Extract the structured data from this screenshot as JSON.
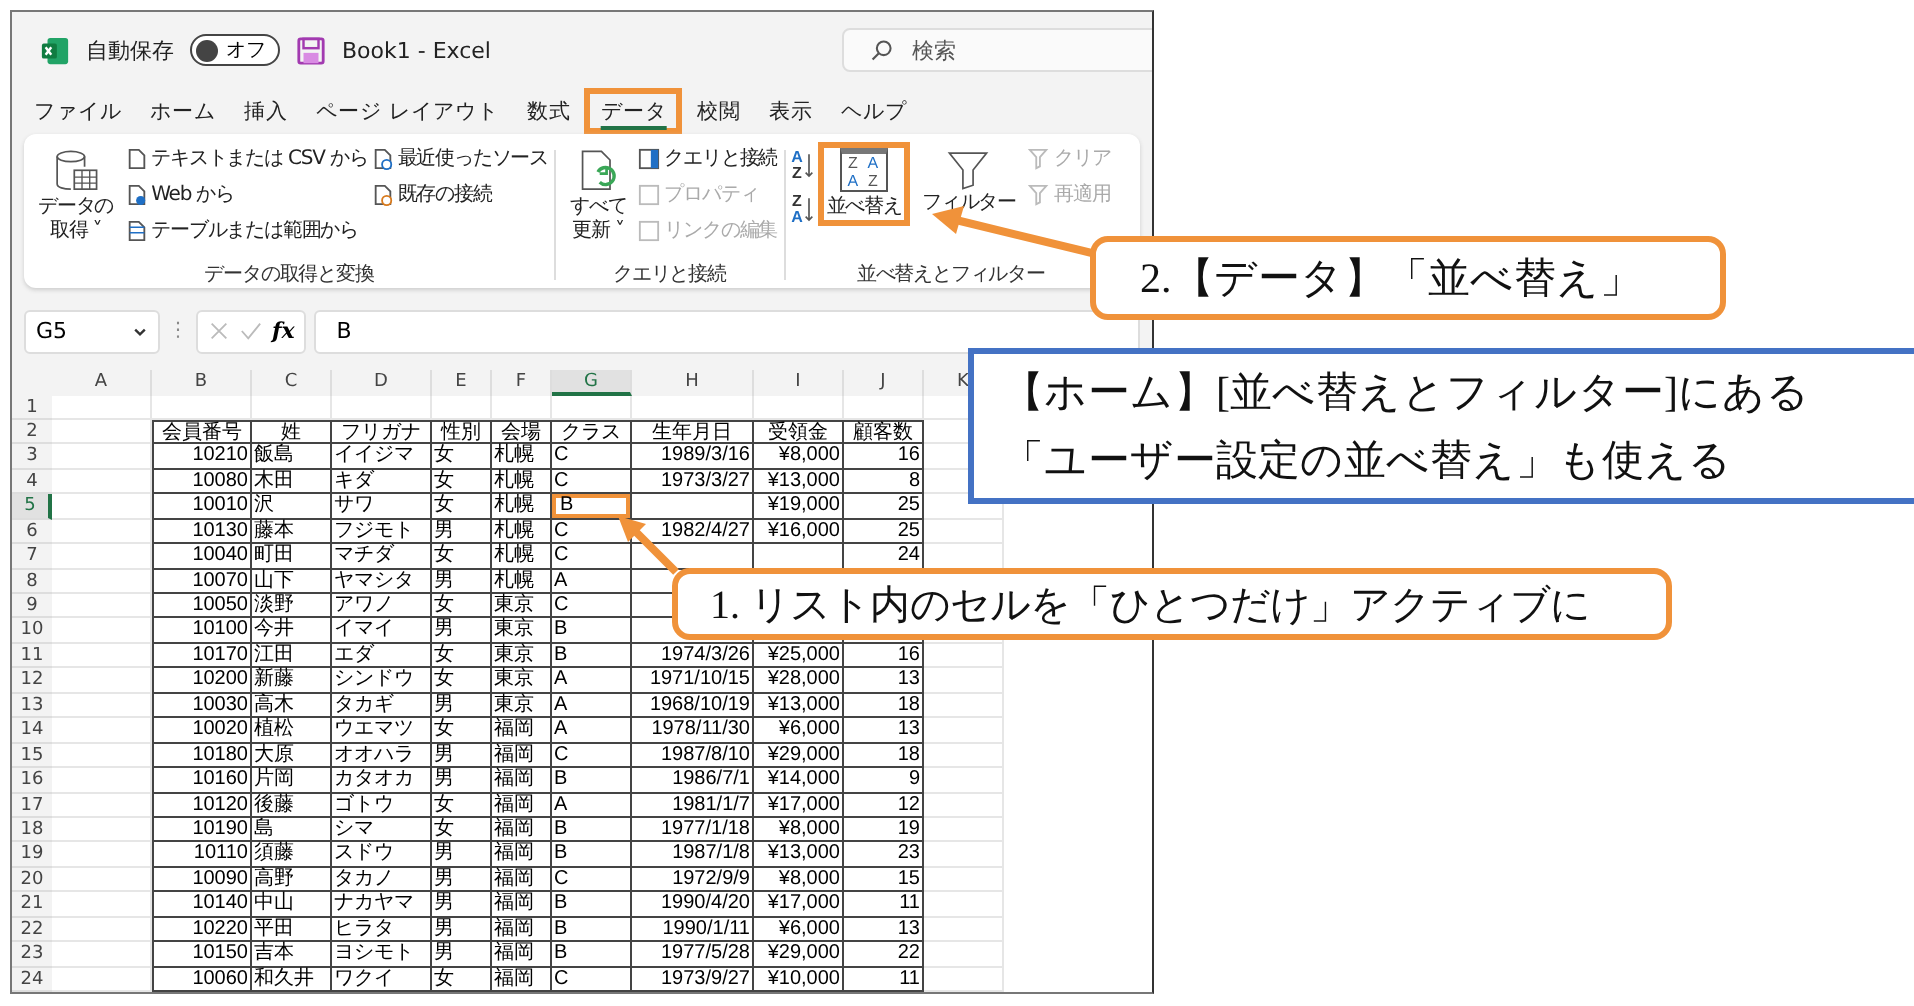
{
  "title_bar": {
    "autosave_label": "自動保存",
    "toggle": {
      "label": "オフ",
      "on": false
    },
    "document_title": "Book1  -  Excel",
    "search": {
      "placeholder": "検索"
    }
  },
  "tabs": [
    {
      "label": "ファイル",
      "selected": false,
      "highlighted": false
    },
    {
      "label": "ホーム",
      "selected": false,
      "highlighted": false
    },
    {
      "label": "挿入",
      "selected": false,
      "highlighted": false
    },
    {
      "label": "ページ レイアウト",
      "selected": false,
      "highlighted": false
    },
    {
      "label": "数式",
      "selected": false,
      "highlighted": false
    },
    {
      "label": "データ",
      "selected": true,
      "highlighted": true
    },
    {
      "label": "校閲",
      "selected": false,
      "highlighted": false
    },
    {
      "label": "表示",
      "selected": false,
      "highlighted": false
    },
    {
      "label": "ヘルプ",
      "selected": false,
      "highlighted": false
    }
  ],
  "ribbon": {
    "groups": [
      {
        "label": "データの取得と変換",
        "large": [
          {
            "label": "データの",
            "label2": "取得 ˅",
            "highlighted": false
          }
        ],
        "small": [
          {
            "label": "テキストまたは CSV から",
            "disabled": false
          },
          {
            "label": "Web から",
            "disabled": false
          },
          {
            "label": "テーブルまたは範囲から",
            "disabled": false
          },
          {
            "label": "最近使ったソース",
            "disabled": false
          },
          {
            "label": "既存の接続",
            "disabled": false
          }
        ]
      },
      {
        "label": "クエリと接続",
        "large": [
          {
            "label": "すべて",
            "label2": "更新 ˅",
            "highlighted": false
          }
        ],
        "small": [
          {
            "label": "クエリと接続",
            "disabled": false
          },
          {
            "label": "プロパティ",
            "disabled": true
          },
          {
            "label": "リンクの編集",
            "disabled": true
          }
        ]
      },
      {
        "label": "並べ替えとフィルター",
        "sort_buttons": [
          {
            "top": "A",
            "bottom": "Z"
          },
          {
            "top": "Z",
            "bottom": "A"
          }
        ],
        "sort_icon_letters": [
          "Z",
          "A",
          "A",
          "Z"
        ],
        "large": [
          {
            "label": "並べ替え",
            "highlighted": true
          },
          {
            "label": "フィルター",
            "highlighted": false
          }
        ],
        "small": [
          {
            "label": "クリア",
            "disabled": true
          },
          {
            "label": "再適用",
            "disabled": true
          }
        ]
      }
    ]
  },
  "formula_bar": {
    "name_box": "G5",
    "separator": "⋮",
    "fx": "fx",
    "value": "B"
  },
  "grid": {
    "active_cell_highlighted": true,
    "columns": [
      {
        "label": "A",
        "selected": false
      },
      {
        "label": "B",
        "selected": false
      },
      {
        "label": "C",
        "selected": false
      },
      {
        "label": "D",
        "selected": false
      },
      {
        "label": "E",
        "selected": false
      },
      {
        "label": "F",
        "selected": false
      },
      {
        "label": "G",
        "selected": true
      },
      {
        "label": "H",
        "selected": false
      },
      {
        "label": "I",
        "selected": false
      },
      {
        "label": "J",
        "selected": false
      },
      {
        "label": "K",
        "selected": false
      }
    ],
    "row_headers": [
      {
        "label": "1",
        "selected": false
      },
      {
        "label": "2",
        "selected": false
      },
      {
        "label": "3",
        "selected": false
      },
      {
        "label": "4",
        "selected": false
      },
      {
        "label": "5",
        "selected": true
      },
      {
        "label": "6",
        "selected": false
      },
      {
        "label": "7",
        "selected": false
      },
      {
        "label": "8",
        "selected": false
      },
      {
        "label": "9",
        "selected": false
      },
      {
        "label": "10",
        "selected": false
      },
      {
        "label": "11",
        "selected": false
      },
      {
        "label": "12",
        "selected": false
      },
      {
        "label": "13",
        "selected": false
      },
      {
        "label": "14",
        "selected": false
      },
      {
        "label": "15",
        "selected": false
      },
      {
        "label": "16",
        "selected": false
      },
      {
        "label": "17",
        "selected": false
      },
      {
        "label": "18",
        "selected": false
      },
      {
        "label": "19",
        "selected": false
      },
      {
        "label": "20",
        "selected": false
      },
      {
        "label": "21",
        "selected": false
      },
      {
        "label": "22",
        "selected": false
      },
      {
        "label": "23",
        "selected": false
      },
      {
        "label": "24",
        "selected": false
      }
    ]
  },
  "table": {
    "columns": [
      "会員番号",
      "姓",
      "フリガナ",
      "性別",
      "会場",
      "クラス",
      "生年月日",
      "受領金",
      "顧客数"
    ],
    "rows": [
      {
        "cells": [
          "10210",
          "飯島",
          "イイジマ",
          "女",
          "札幌",
          "C",
          "1989/3/16",
          "¥8,000",
          "16"
        ]
      },
      {
        "cells": [
          "10080",
          "木田",
          "キダ",
          "女",
          "札幌",
          "C",
          "1973/3/27",
          "¥13,000",
          "8"
        ]
      },
      {
        "cells": [
          "10010",
          "沢",
          "サワ",
          "女",
          "札幌",
          "B",
          null,
          "¥19,000",
          "25"
        ]
      },
      {
        "cells": [
          "10130",
          "藤本",
          "フジモト",
          "男",
          "札幌",
          "C",
          "1982/4/27",
          "¥16,000",
          "25"
        ]
      },
      {
        "cells": [
          "10040",
          "町田",
          "マチダ",
          "女",
          "札幌",
          "C",
          null,
          null,
          "24"
        ]
      },
      {
        "cells": [
          "10070",
          "山下",
          "ヤマシタ",
          "男",
          "札幌",
          "A",
          null,
          null,
          null
        ]
      },
      {
        "cells": [
          "10050",
          "淡野",
          "アワノ",
          "女",
          "東京",
          "C",
          null,
          null,
          null
        ]
      },
      {
        "cells": [
          "10100",
          "今井",
          "イマイ",
          "男",
          "東京",
          "B",
          null,
          null,
          null
        ]
      },
      {
        "cells": [
          "10170",
          "江田",
          "エダ",
          "女",
          "東京",
          "B",
          "1974/3/26",
          "¥25,000",
          "16"
        ]
      },
      {
        "cells": [
          "10200",
          "新藤",
          "シンドウ",
          "女",
          "東京",
          "A",
          "1971/10/15",
          "¥28,000",
          "13"
        ]
      },
      {
        "cells": [
          "10030",
          "高木",
          "タカギ",
          "男",
          "東京",
          "A",
          "1968/10/19",
          "¥13,000",
          "18"
        ]
      },
      {
        "cells": [
          "10020",
          "植松",
          "ウエマツ",
          "女",
          "福岡",
          "A",
          "1978/11/30",
          "¥6,000",
          "13"
        ]
      },
      {
        "cells": [
          "10180",
          "大原",
          "オオハラ",
          "男",
          "福岡",
          "C",
          "1987/8/10",
          "¥29,000",
          "18"
        ]
      },
      {
        "cells": [
          "10160",
          "片岡",
          "カタオカ",
          "男",
          "福岡",
          "B",
          "1986/7/1",
          "¥14,000",
          "9"
        ]
      },
      {
        "cells": [
          "10120",
          "後藤",
          "ゴトウ",
          "女",
          "福岡",
          "A",
          "1981/1/7",
          "¥17,000",
          "12"
        ]
      },
      {
        "cells": [
          "10190",
          "島",
          "シマ",
          "女",
          "福岡",
          "B",
          "1977/1/18",
          "¥8,000",
          "19"
        ]
      },
      {
        "cells": [
          "10110",
          "須藤",
          "スドウ",
          "男",
          "福岡",
          "B",
          "1987/1/8",
          "¥13,000",
          "23"
        ]
      },
      {
        "cells": [
          "10090",
          "高野",
          "タカノ",
          "男",
          "福岡",
          "C",
          "1972/9/9",
          "¥8,000",
          "15"
        ]
      },
      {
        "cells": [
          "10140",
          "中山",
          "ナカヤマ",
          "男",
          "福岡",
          "B",
          "1990/4/20",
          "¥17,000",
          "11"
        ]
      },
      {
        "cells": [
          "10220",
          "平田",
          "ヒラタ",
          "男",
          "福岡",
          "B",
          "1990/1/11",
          "¥6,000",
          "13"
        ]
      },
      {
        "cells": [
          "10150",
          "吉本",
          "ヨシモト",
          "男",
          "福岡",
          "B",
          "1977/5/28",
          "¥29,000",
          "22"
        ]
      },
      {
        "cells": [
          "10060",
          "和久井",
          "ワクイ",
          "女",
          "福岡",
          "C",
          "1973/9/27",
          "¥10,000",
          "11"
        ]
      }
    ]
  },
  "callouts": [
    {
      "kind": "orange",
      "arrow": true,
      "lines": [
        "2.【データ】「並べ替え」"
      ]
    },
    {
      "kind": "blue",
      "arrow": false,
      "lines": [
        "【ホーム】[並べ替えとフィルター]にある",
        "「ユーザー設定の並べ替え」も使える"
      ]
    },
    {
      "kind": "orange",
      "arrow": true,
      "lines": [
        "1. リスト内のセルを「ひとつだけ」アクティブに"
      ]
    }
  ]
}
